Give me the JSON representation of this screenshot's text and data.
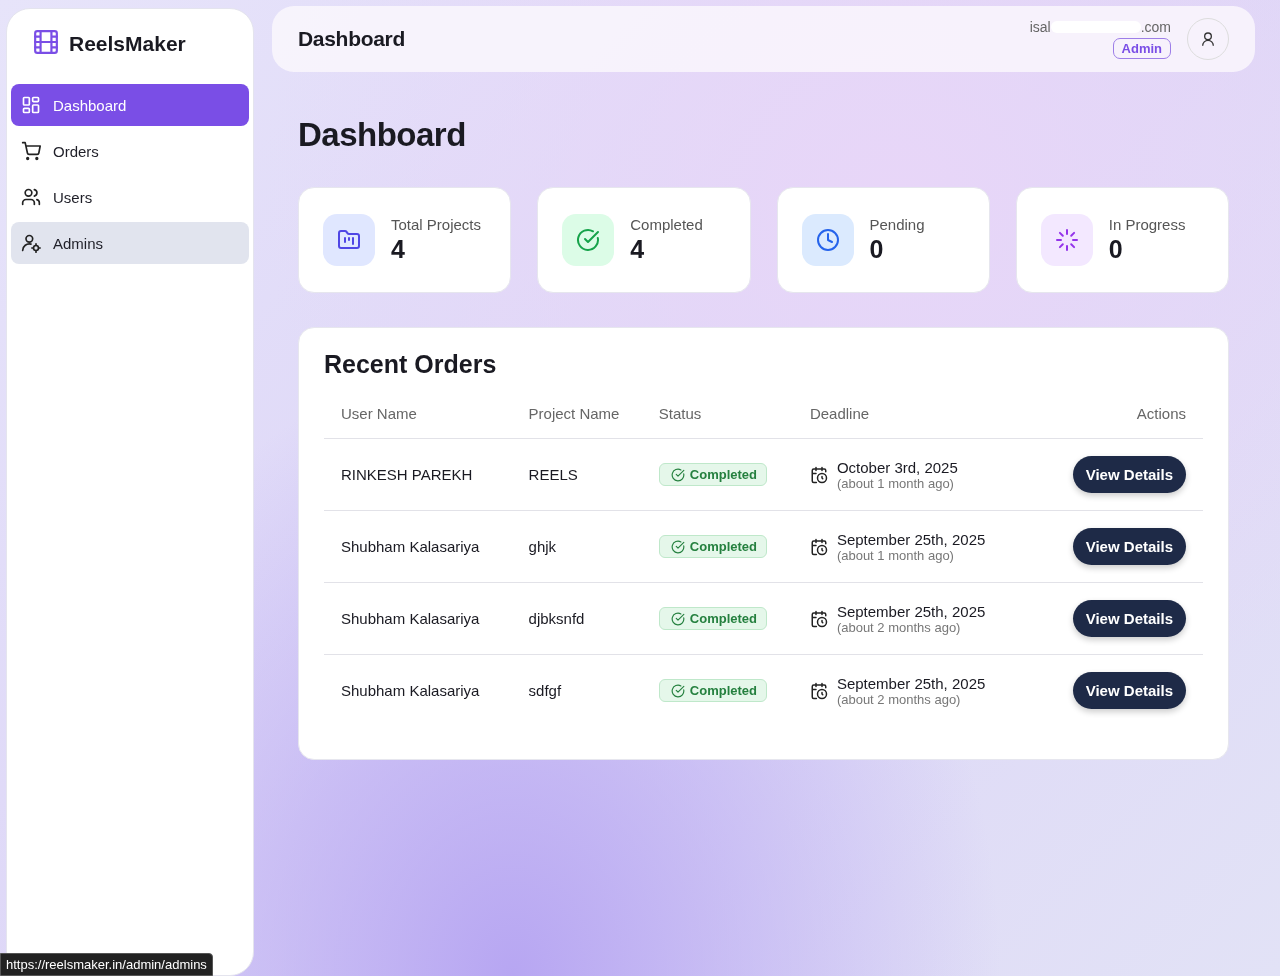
{
  "sidebar": {
    "brand": "ReelsMaker",
    "items": [
      {
        "label": "Dashboard",
        "selected": true,
        "hovered": false
      },
      {
        "label": "Orders",
        "selected": false,
        "hovered": false
      },
      {
        "label": "Users",
        "selected": false,
        "hovered": false
      },
      {
        "label": "Admins",
        "selected": false,
        "hovered": true
      }
    ]
  },
  "header": {
    "title": "Dashboard",
    "email_start": "isal",
    "email_end": ".com",
    "role": "Admin"
  },
  "page_title": "Dashboard",
  "stats": [
    {
      "label": "Total Projects",
      "value": "4"
    },
    {
      "label": "Completed",
      "value": "4"
    },
    {
      "label": "Pending",
      "value": "0"
    },
    {
      "label": "In Progress",
      "value": "0"
    }
  ],
  "recent_orders": {
    "title": "Recent Orders",
    "columns": [
      "User Name",
      "Project Name",
      "Status",
      "Deadline",
      "Actions"
    ],
    "rows": [
      {
        "user": "RINKESH PAREKH",
        "project": "REELS",
        "status": "Completed",
        "kind": "completed",
        "deadline": "October 3rd, 2025",
        "relative": "(about 1 month ago)",
        "action": "View Details"
      },
      {
        "user": "Shubham Kalasariya",
        "project": "ghjk",
        "status": "Completed",
        "kind": "completed",
        "deadline": "September 25th, 2025",
        "relative": "(about 1 month ago)",
        "action": "View Details"
      },
      {
        "user": "Shubham Kalasariya",
        "project": "djbksnfd",
        "status": "Completed",
        "kind": "completed",
        "deadline": "September 25th, 2025",
        "relative": "(about 2 months ago)",
        "action": "View Details"
      },
      {
        "user": "Shubham Kalasariya",
        "project": "sdfgf",
        "status": "Completed",
        "kind": "completed",
        "deadline": "September 25th, 2025",
        "relative": "(about 2 months ago)",
        "action": "View Details"
      }
    ]
  },
  "status_bar": {
    "url": "https://reelsmaker.in/admin/admins"
  }
}
